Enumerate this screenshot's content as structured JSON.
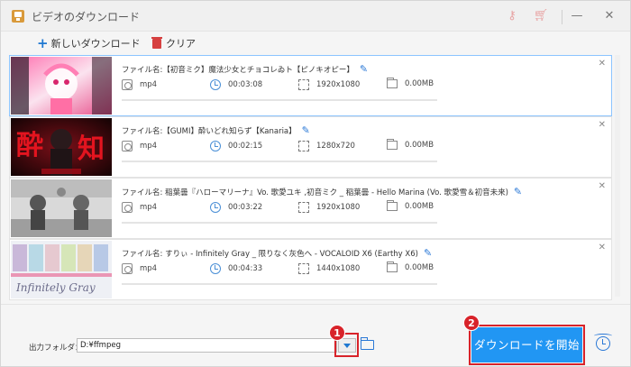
{
  "window": {
    "title": "ビデオのダウンロード"
  },
  "toolbar": {
    "new_download": "新しいダウンロード",
    "clear": "クリア"
  },
  "downloads": [
    {
      "filename": "ファイル名:【初音ミク】魔法少女とチョコレゐト【ピノキオピー】",
      "format": "mp4",
      "duration": "00:03:08",
      "resolution": "1920x1080",
      "size": "0.00MB",
      "progress": 0,
      "selected": true
    },
    {
      "filename": "ファイル名:【GUMI】酔いどれ知らず【Kanaria】",
      "format": "mp4",
      "duration": "00:02:15",
      "resolution": "1280x720",
      "size": "0.00MB",
      "progress": 0,
      "selected": false
    },
    {
      "filename": "ファイル名: 稲葉曇『ハローマリーナ』Vo. 歌愛ユキ ,初音ミク _ 稲葉曇 - Hello Marina (Vo. 歌愛雪＆初音未来)",
      "format": "mp4",
      "duration": "00:03:22",
      "resolution": "1920x1080",
      "size": "0.00MB",
      "progress": 0,
      "selected": false
    },
    {
      "filename": "ファイル名: すりぃ - Infinitely Gray _ 限りなく灰色へ - VOCALOID X6 (Earthy X6)",
      "format": "mp4",
      "duration": "00:04:33",
      "resolution": "1440x1080",
      "size": "0.00MB",
      "progress": 0,
      "selected": false
    }
  ],
  "output": {
    "label": "出力フォルダ：",
    "path": "D:¥ffmpeg"
  },
  "start_button": "ダウンロードを開始",
  "annotations": {
    "badge1": "1",
    "badge2": "2"
  },
  "thumb4_text": "Infinitely Gray",
  "icons": {
    "format": "video-format-icon",
    "duration": "clock-icon",
    "resolution": "resolution-icon",
    "size": "folder-size-icon",
    "edit": "pencil-icon",
    "remove": "close-icon",
    "folder": "open-folder-icon",
    "alarm": "alarm-clock-icon"
  },
  "colors": {
    "accent": "#2196f3",
    "annotation": "#d8232a"
  }
}
